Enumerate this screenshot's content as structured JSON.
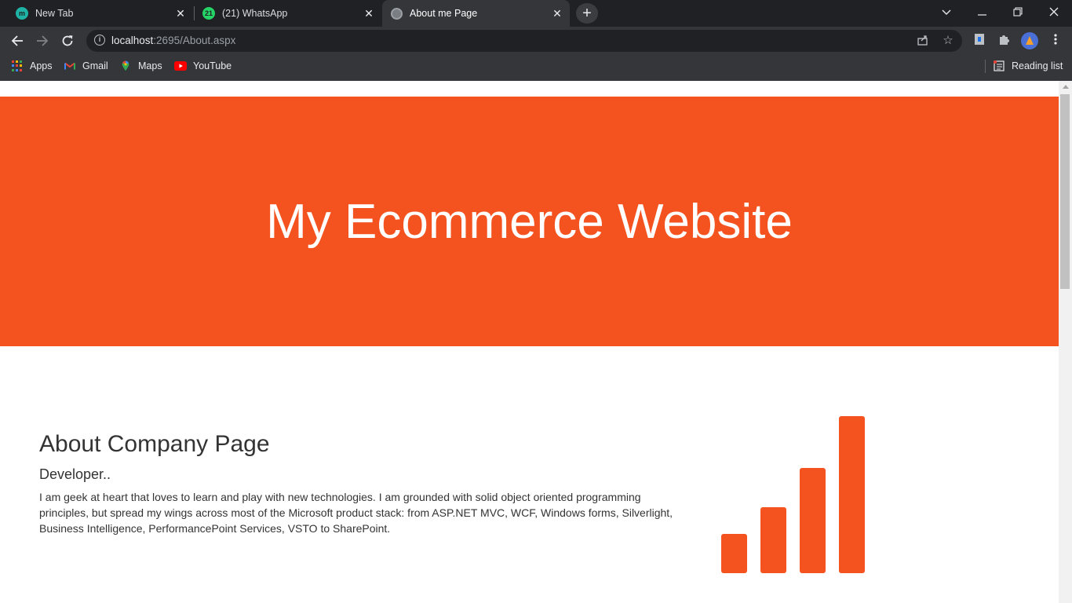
{
  "browser": {
    "tabs": [
      {
        "title": "New Tab",
        "favicon": "m",
        "favicon_color": "#1fb3a6",
        "active": false
      },
      {
        "title": "(21) WhatsApp",
        "favicon": "21",
        "favicon_color": "#25d366",
        "active": false
      },
      {
        "title": "About me Page",
        "favicon": "globe",
        "favicon_color": "#5f6368",
        "active": true
      }
    ],
    "url_host": "localhost",
    "url_path": ":2695/About.aspx",
    "bookmarks": [
      {
        "label": "Apps",
        "icon": "apps-grid-icon"
      },
      {
        "label": "Gmail",
        "icon": "gmail-icon"
      },
      {
        "label": "Maps",
        "icon": "maps-icon"
      },
      {
        "label": "YouTube",
        "icon": "youtube-icon"
      }
    ],
    "reading_list": "Reading list"
  },
  "page": {
    "hero_title": "My Ecommerce Website",
    "about_title": "About Company Page",
    "about_subtitle": "Developer..",
    "about_text": "I am geek at heart that loves to learn and play with new technologies. I am grounded with solid object oriented programming principles, but spread my wings across most of the Microsoft product stack: from ASP.NET MVC, WCF, Windows forms, Silverlight, Business Intelligence, PerformancePoint Services, VSTO to SharePoint."
  },
  "theme": {
    "accent": "#f45320",
    "chrome_dark": "#202124",
    "chrome_mid": "#35363a"
  },
  "bar_icon_levels": [
    0.25,
    0.42,
    0.67,
    1.0
  ]
}
